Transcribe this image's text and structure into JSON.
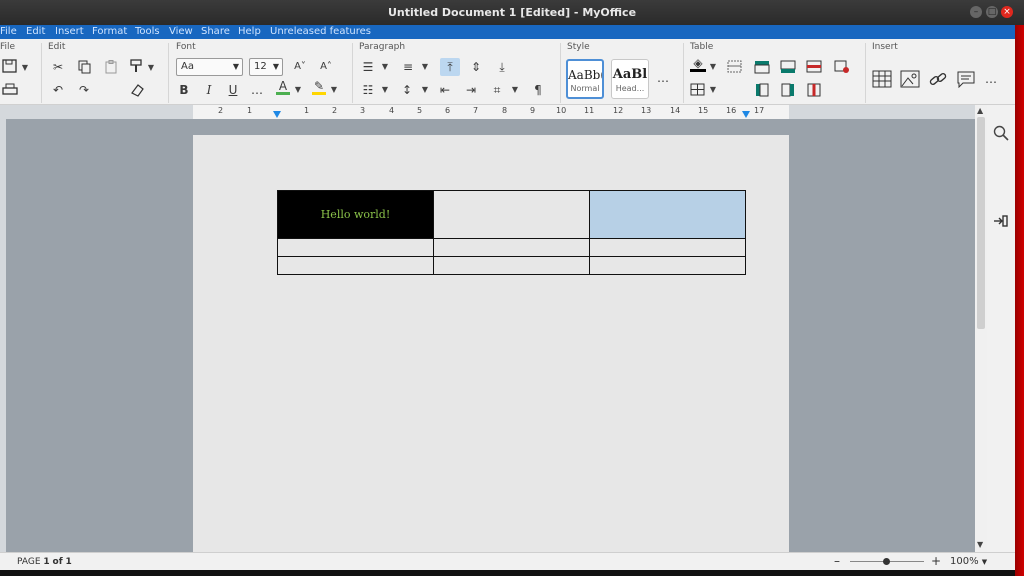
{
  "window": {
    "title": "Untitled Document 1 [Edited] - MyOffice"
  },
  "menu": [
    "File",
    "Edit",
    "Insert",
    "Format",
    "Tools",
    "View",
    "Share",
    "Help",
    "Unreleased features"
  ],
  "groups": {
    "file": "File",
    "edit": "Edit",
    "font": "Font",
    "paragraph": "Paragraph",
    "style": "Style",
    "table": "Table",
    "insert": "Insert"
  },
  "font": {
    "family": "Aa",
    "size": "12",
    "decrease": "A˅",
    "increase": "A˄",
    "bold": "B",
    "italic": "I",
    "underline": "U",
    "more": "…"
  },
  "styles": [
    {
      "preview": "AaBb(",
      "name": "Normal"
    },
    {
      "preview": "AaBl",
      "name": "Head..."
    }
  ],
  "more": "…",
  "ruler": [
    "2",
    "1",
    "1",
    "2",
    "3",
    "4",
    "5",
    "6",
    "7",
    "8",
    "9",
    "10",
    "11",
    "12",
    "13",
    "14",
    "15",
    "16",
    "17"
  ],
  "table": {
    "cell_text": "Hello world!"
  },
  "status": {
    "page_label": "PAGE",
    "page_current": "1",
    "page_of": "of",
    "page_total": "1",
    "zoom": "100%"
  },
  "colors": {
    "menubar": "#1867c0",
    "font_color": "#4caf50",
    "highlight": "#ffd600",
    "cell_blue": "#b7d0e6",
    "cell_text": "#8bc34a"
  }
}
